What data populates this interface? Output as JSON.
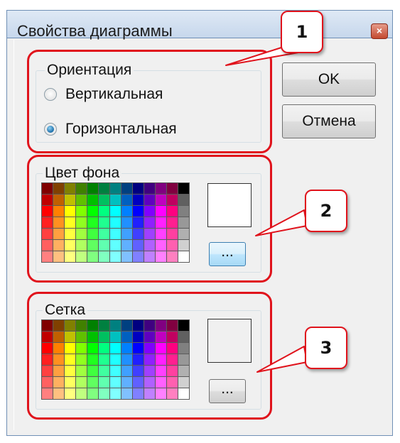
{
  "window": {
    "title": "Свойства диаграммы",
    "close_glyph": "×"
  },
  "orientation": {
    "label": "Ориентация",
    "options": [
      {
        "label": "Вертикальная",
        "checked": false
      },
      {
        "label": "Горизонтальная",
        "checked": true
      }
    ]
  },
  "buttons": {
    "ok": "OK",
    "cancel": "Отмена"
  },
  "background": {
    "label": "Цвет фона",
    "more_label": "...",
    "selected_color": "#ffffff"
  },
  "grid": {
    "label": "Сетка",
    "more_label": "...",
    "selected_color": "#f0f0f0"
  },
  "callouts": [
    "1",
    "2",
    "3"
  ],
  "palette": {
    "rows": [
      [
        "#800000",
        "#804000",
        "#808000",
        "#408000",
        "#008000",
        "#008040",
        "#008080",
        "#004080",
        "#000080",
        "#400080",
        "#800080",
        "#800040"
      ],
      [
        "#c00000",
        "#c06000",
        "#c0c000",
        "#60c000",
        "#00c000",
        "#00c060",
        "#00c0c0",
        "#0060c0",
        "#0000c0",
        "#6000c0",
        "#c000c0",
        "#c00060"
      ],
      [
        "#ff0000",
        "#ff8000",
        "#ffff00",
        "#80ff00",
        "#00ff00",
        "#00ff80",
        "#00ffff",
        "#0080ff",
        "#0000ff",
        "#8000ff",
        "#ff00ff",
        "#ff0080"
      ],
      [
        "#ff2020",
        "#ff9020",
        "#ffff20",
        "#90ff20",
        "#20ff20",
        "#20ff90",
        "#20ffff",
        "#2090ff",
        "#2020ff",
        "#9020ff",
        "#ff20ff",
        "#ff2090"
      ],
      [
        "#ff4040",
        "#ffa040",
        "#ffff40",
        "#a0ff40",
        "#40ff40",
        "#40ffa0",
        "#40ffff",
        "#40a0ff",
        "#4040ff",
        "#a040ff",
        "#ff40ff",
        "#ff40a0"
      ],
      [
        "#ff6060",
        "#ffb060",
        "#ffff60",
        "#b0ff60",
        "#60ff60",
        "#60ffb0",
        "#60ffff",
        "#60b0ff",
        "#6060ff",
        "#b060ff",
        "#ff60ff",
        "#ff60b0"
      ],
      [
        "#ff8080",
        "#ffc080",
        "#ffff80",
        "#c0ff80",
        "#80ff80",
        "#80ffc0",
        "#80ffff",
        "#80c0ff",
        "#8080ff",
        "#c080ff",
        "#ff80ff",
        "#ff80c0"
      ]
    ],
    "last_column": [
      "#000000",
      "#606060",
      "#808080",
      "#989898",
      "#b0b0b0",
      "#d0d0d0",
      "#ffffff"
    ]
  }
}
